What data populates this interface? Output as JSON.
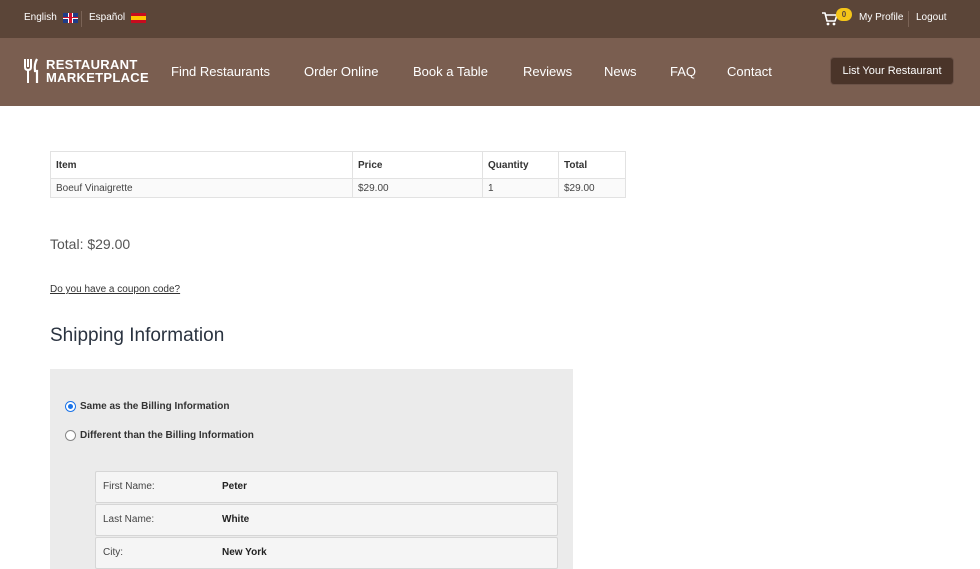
{
  "topbar": {
    "lang_en": "English",
    "lang_es": "Español",
    "cart_count": "0",
    "my_profile": "My Profile",
    "logout": "Logout"
  },
  "nav": {
    "logo_line1": "RESTAURANT",
    "logo_line2": "MARKETPLACE",
    "items": [
      "Find Restaurants",
      "Order Online",
      "Book a Table",
      "Reviews",
      "News",
      "FAQ",
      "Contact"
    ],
    "cta": "List Your Restaurant"
  },
  "cart": {
    "headers": [
      "Item",
      "Price",
      "Quantity",
      "Total"
    ],
    "rows": [
      [
        "Boeuf Vinaigrette",
        "$29.00",
        "1",
        "$29.00"
      ]
    ],
    "total": "Total: $29.00",
    "coupon": "Do you have a coupon code?"
  },
  "shipping": {
    "title": "Shipping Information",
    "option_same": "Same as the Billing Information",
    "option_different": "Different than the Billing Information",
    "fields": [
      {
        "label": "First Name:",
        "value": "Peter"
      },
      {
        "label": "Last Name:",
        "value": "White"
      },
      {
        "label": "City:",
        "value": "New York"
      }
    ]
  },
  "colors": {
    "topbar": "#5b4538",
    "navbar": "#7a5e50",
    "cta": "#4a3429",
    "badge": "#f5c518",
    "radio": "#1a73e8"
  }
}
